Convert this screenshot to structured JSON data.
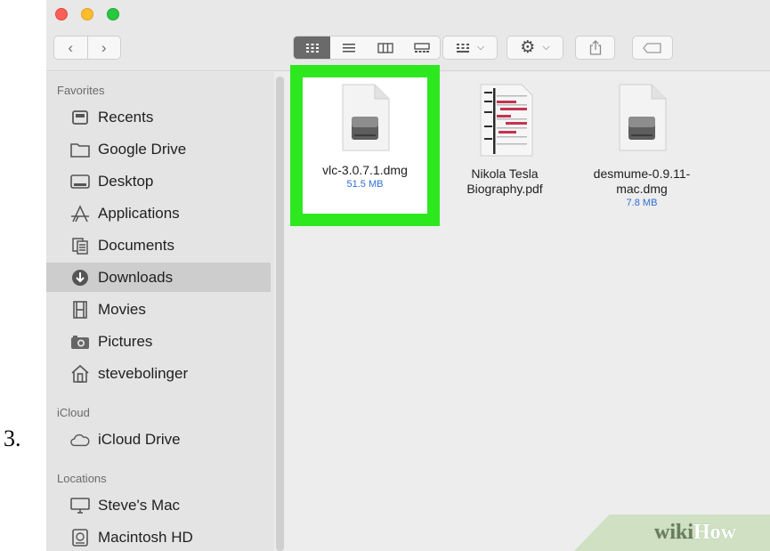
{
  "step_number": "3.",
  "toolbar": {
    "back_icon": "chevron-left-icon",
    "forward_icon": "chevron-right-icon",
    "view_icons": [
      "icon-view-icon",
      "list-view-icon",
      "column-view-icon",
      "gallery-view-icon"
    ],
    "arrange_icon": "grid-arrange-icon",
    "action_icon": "gear-icon",
    "share_icon": "share-icon",
    "tag_icon": "tag-icon"
  },
  "sidebar": {
    "favorites_title": "Favorites",
    "favorites": [
      {
        "label": "Recents",
        "icon": "clock-icon"
      },
      {
        "label": "Google Drive",
        "icon": "folder-icon"
      },
      {
        "label": "Desktop",
        "icon": "desktop-icon"
      },
      {
        "label": "Applications",
        "icon": "applications-icon"
      },
      {
        "label": "Documents",
        "icon": "documents-icon"
      },
      {
        "label": "Downloads",
        "icon": "download-icon"
      },
      {
        "label": "Movies",
        "icon": "film-icon"
      },
      {
        "label": "Pictures",
        "icon": "camera-icon"
      },
      {
        "label": "stevebolinger",
        "icon": "home-icon"
      }
    ],
    "icloud_title": "iCloud",
    "icloud": [
      {
        "label": "iCloud Drive",
        "icon": "cloud-icon"
      }
    ],
    "locations_title": "Locations",
    "locations": [
      {
        "label": "Steve's Mac",
        "icon": "monitor-icon"
      },
      {
        "label": "Macintosh HD",
        "icon": "disk-icon"
      }
    ],
    "selected": "Downloads"
  },
  "files": [
    {
      "name": "vlc-3.0.7.1.dmg",
      "size": "51.5 MB",
      "icon": "disk-image-icon",
      "highlighted": true
    },
    {
      "name_line1": "Nikola Tesla",
      "name_line2": "Biography.pdf",
      "icon": "pdf-document-icon"
    },
    {
      "name_line1": "desmume-0.9.11-",
      "name_line2": "mac.dmg",
      "size": "7.8 MB",
      "icon": "disk-image-icon"
    }
  ],
  "watermark": {
    "wiki": "wiki",
    "how": "How"
  },
  "colors": {
    "highlight": "#2ee81f",
    "size_text": "#2f6fd1",
    "selected_row": "#cdcdcd"
  }
}
